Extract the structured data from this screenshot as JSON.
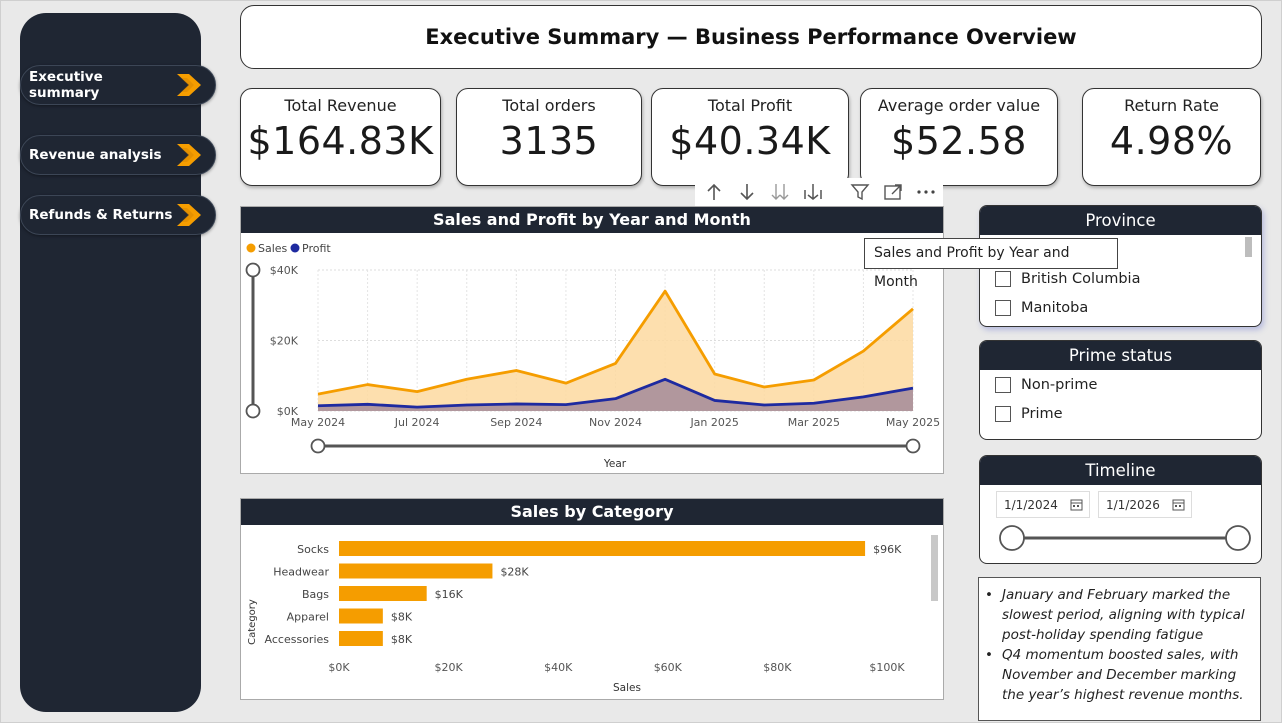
{
  "nav": {
    "items": [
      {
        "label": "Executive summary"
      },
      {
        "label": "Revenue analysis"
      },
      {
        "label": "Refunds & Returns"
      }
    ]
  },
  "header": {
    "title": "Executive Summary — Business Performance Overview"
  },
  "kpis": [
    {
      "label": "Total Revenue",
      "value": "$164.83K"
    },
    {
      "label": "Total orders",
      "value": "3135"
    },
    {
      "label": "Total Profit",
      "value": "$40.34K"
    },
    {
      "label": "Average order value",
      "value": "$52.58"
    },
    {
      "label": "Return Rate",
      "value": "4.98%"
    }
  ],
  "toolbar": {
    "icons": [
      "arrow-up-icon",
      "arrow-down-icon",
      "double-arrow-down-icon",
      "expand-hierarchy-icon",
      "filter-icon",
      "focus-mode-icon",
      "more-options-icon"
    ]
  },
  "colors": {
    "sales": "#f59d00",
    "sales_fill": "#fdd9a0",
    "profit": "#1e2aa0",
    "profit_fill": "#a98f9b",
    "header_bg": "#1f2633",
    "bar": "#f59d00",
    "arrow": "#f59d00"
  },
  "chart_data": [
    {
      "type": "area",
      "title": "Sales and Profit by Year and Month",
      "xlabel": "Year",
      "ylabel": "",
      "x": [
        "May 2024",
        "Jun 2024",
        "Jul 2024",
        "Aug 2024",
        "Sep 2024",
        "Oct 2024",
        "Nov 2024",
        "Dec 2024",
        "Jan 2025",
        "Feb 2025",
        "Mar 2025",
        "Apr 2025",
        "May 2025"
      ],
      "x_tick_labels": [
        "May 2024",
        "Jul 2024",
        "Sep 2024",
        "Nov 2024",
        "Jan 2025",
        "Mar 2025",
        "May 2025"
      ],
      "y_tick_labels": [
        "$0K",
        "$20K",
        "$40K"
      ],
      "ylim": [
        0,
        40000
      ],
      "legend": "top-left",
      "grid": true,
      "series": [
        {
          "name": "Sales",
          "values": [
            4800,
            7500,
            5500,
            9000,
            11500,
            7900,
            13500,
            34000,
            10500,
            6800,
            8800,
            17000,
            29000
          ]
        },
        {
          "name": "Profit",
          "values": [
            1500,
            1900,
            1100,
            1700,
            2000,
            1800,
            3500,
            9000,
            3000,
            1700,
            2200,
            4000,
            6500
          ]
        }
      ]
    },
    {
      "type": "bar",
      "orientation": "horizontal",
      "title": "Sales by Category",
      "xlabel": "Sales",
      "ylabel": "Category",
      "categories": [
        "Socks",
        "Headwear",
        "Bags",
        "Apparel",
        "Accessories"
      ],
      "values": [
        96000,
        28000,
        16000,
        8000,
        8000
      ],
      "data_labels": [
        "$96K",
        "$28K",
        "$16K",
        "$8K",
        "$8K"
      ],
      "x_tick_labels": [
        "$0K",
        "$20K",
        "$40K",
        "$60K",
        "$80K",
        "$100K"
      ],
      "xlim": [
        0,
        105000
      ],
      "grid": false
    }
  ],
  "tooltip": {
    "text": "Sales and Profit by Year and Month"
  },
  "slicers": {
    "province": {
      "title": "Province",
      "options": [
        "British Columbia",
        "Manitoba"
      ]
    },
    "prime": {
      "title": "Prime status",
      "options": [
        "Non-prime",
        "Prime"
      ]
    },
    "timeline": {
      "title": "Timeline",
      "start": "1/1/2024",
      "end": "1/1/2026"
    }
  },
  "notes": {
    "items": [
      "January and February marked the slowest period, aligning with typical post-holiday spending fatigue",
      "Q4 momentum boosted sales, with November and December marking the year’s highest revenue months."
    ]
  }
}
